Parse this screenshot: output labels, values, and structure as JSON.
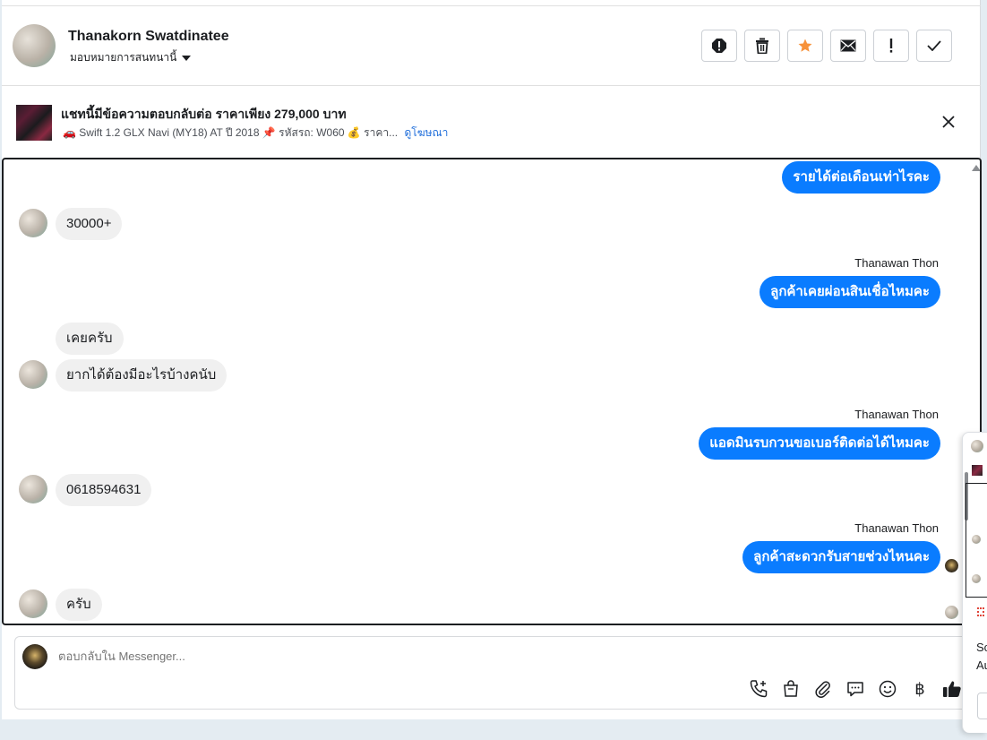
{
  "header": {
    "name": "Thanakorn Swatdinatee",
    "assign_label": "มอบหมายการสนทนานี้",
    "actions": [
      "spam-icon",
      "trash-icon",
      "star-icon",
      "mail-icon",
      "alert-icon",
      "check-icon"
    ],
    "star_color": "#f7923b"
  },
  "ad": {
    "title": "แชทนี้มีข้อความตอบกลับต่อ ราคาเพียง 279,000 บาท",
    "subtitle": "🚗 Swift 1.2 GLX Navi (MY18) AT ปี 2018 📌 รหัสรถ: W060 💰 ราคา...",
    "link": "ดูโฆษณา"
  },
  "messages": [
    {
      "dir": "out",
      "sender": "",
      "text": "รายได้ต่อเดือนเท่าไรคะ"
    },
    {
      "dir": "in",
      "text": "30000+"
    },
    {
      "dir": "out",
      "sender": "Thanawan Thon",
      "text": "ลูกค้าเคยผ่อนสินเชื่อไหมคะ"
    },
    {
      "dir": "in",
      "text": "เคยครับ"
    },
    {
      "dir": "in",
      "text": "ยากได้ต้องมีอะไรบ้างคนับ"
    },
    {
      "dir": "out",
      "sender": "Thanawan Thon",
      "text": "แอดมินรบกวนขอเบอร์ติดต่อได้ไหมคะ"
    },
    {
      "dir": "in",
      "text": "0618594631"
    },
    {
      "dir": "out",
      "sender": "Thanawan Thon",
      "text": "ลูกค้าสะดวกรับสายช่วงไหนคะ"
    },
    {
      "dir": "in",
      "text": "ครับ"
    }
  ],
  "composer": {
    "placeholder": "ตอบกลับใน Messenger...",
    "tools": [
      "call-add-icon",
      "shopping-bag-icon",
      "paperclip-icon",
      "speech-bubble-icon",
      "emoji-icon",
      "baht-icon",
      "thumbs-up-icon"
    ],
    "baht_symbol": "฿"
  },
  "side_popup": {
    "frag1": "Sc",
    "frag2": "Au"
  },
  "colors": {
    "outgoing_bubble": "#0a7cff",
    "incoming_bubble": "#f0f0f0",
    "link": "#216fdb"
  }
}
